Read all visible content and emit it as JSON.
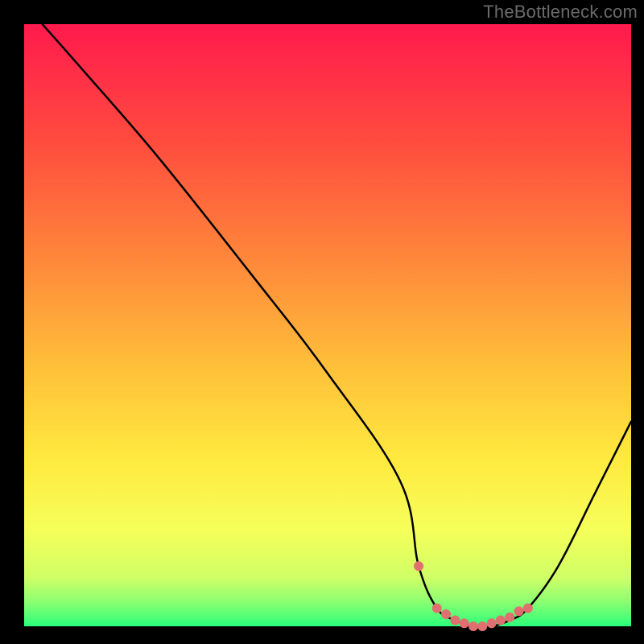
{
  "watermark": "TheBottleneck.com",
  "chart_data": {
    "type": "line",
    "title": "",
    "xlabel": "",
    "ylabel": "",
    "xlim": [
      0,
      100
    ],
    "ylim": [
      0,
      100
    ],
    "x": [
      3,
      10,
      22,
      37,
      50,
      62,
      65,
      68,
      71,
      74,
      77,
      80,
      83,
      88,
      94,
      100
    ],
    "values": [
      100,
      92,
      78,
      59,
      42,
      24,
      10,
      3,
      1,
      0,
      0,
      1,
      3,
      10,
      22,
      34
    ],
    "marker_points": {
      "x": [
        65,
        68,
        69.5,
        71,
        72.5,
        74,
        75.5,
        77,
        78.5,
        80,
        81.5,
        83
      ],
      "values": [
        10,
        3,
        2,
        1,
        0.5,
        0,
        0,
        0.5,
        1,
        1.5,
        2.5,
        3
      ]
    },
    "gradient_stops": [
      {
        "offset": 0.0,
        "color": "#ff1a4d"
      },
      {
        "offset": 0.2,
        "color": "#ff4d3e"
      },
      {
        "offset": 0.4,
        "color": "#ff8a3a"
      },
      {
        "offset": 0.58,
        "color": "#ffc33a"
      },
      {
        "offset": 0.72,
        "color": "#ffe93f"
      },
      {
        "offset": 0.84,
        "color": "#f6ff5a"
      },
      {
        "offset": 0.92,
        "color": "#cfff66"
      },
      {
        "offset": 0.96,
        "color": "#8aff72"
      },
      {
        "offset": 1.0,
        "color": "#2bff7a"
      }
    ],
    "line_color": "#000000",
    "marker_color": "#e07070",
    "marker_radius": 6
  }
}
